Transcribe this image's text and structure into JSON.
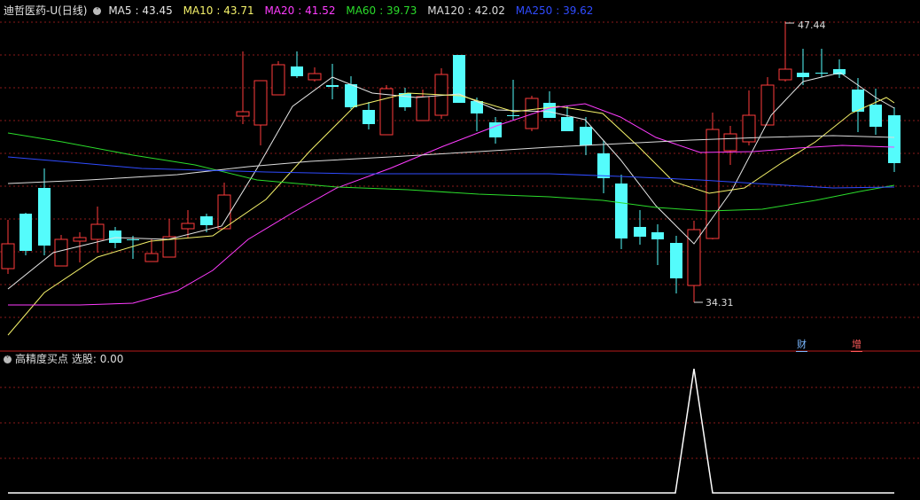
{
  "header": {
    "stock_name": "迪哲医药-U(日线)",
    "collapse_icon": "chevron-down-icon",
    "ma_items": [
      {
        "label": "MA5",
        "value": "43.45",
        "color": "#e6e6e6"
      },
      {
        "label": "MA10",
        "value": "43.71",
        "color": "#f5f26a"
      },
      {
        "label": "MA20",
        "value": "41.52",
        "color": "#ff3cff"
      },
      {
        "label": "MA60",
        "value": "39.73",
        "color": "#2bdc2b"
      },
      {
        "label": "MA120",
        "value": "42.02",
        "color": "#dcdcdc"
      },
      {
        "label": "MA250",
        "value": "39.62",
        "color": "#2f4bff"
      }
    ]
  },
  "sub_panel": {
    "title": "高精度买点",
    "stat_label": "选股:",
    "stat_value": "0.00"
  },
  "badges": {
    "finance": "财",
    "increase": "增"
  },
  "chart_data": {
    "type": "candlestick",
    "high_marker": "47.44",
    "low_marker": "34.31",
    "up_color": "#ff3b3b",
    "down_color": "#54fcfc",
    "grid": true,
    "indicator": {
      "name": "高精度买点",
      "type": "line",
      "signal_count": 1
    }
  }
}
